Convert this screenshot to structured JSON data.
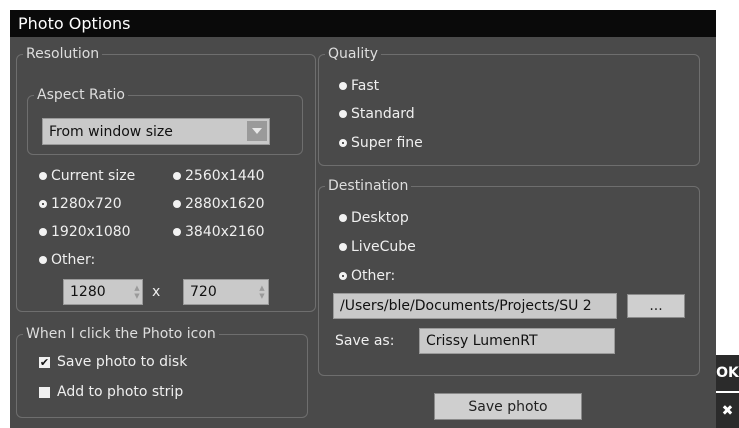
{
  "window": {
    "title": "Photo Options"
  },
  "resolution": {
    "legend": "Resolution",
    "aspect_ratio": {
      "legend": "Aspect Ratio",
      "selected": "From window size"
    },
    "options": [
      {
        "label": "Current size",
        "selected": false
      },
      {
        "label": "2560x1440",
        "selected": false
      },
      {
        "label": "1280x720",
        "selected": true
      },
      {
        "label": "2880x1620",
        "selected": false
      },
      {
        "label": "1920x1080",
        "selected": false
      },
      {
        "label": "3840x2160",
        "selected": false
      },
      {
        "label": "Other:",
        "selected": false
      }
    ],
    "width_value": "1280",
    "height_value": "720",
    "times": "x"
  },
  "photo_icon": {
    "legend": "When I click the Photo icon",
    "save_to_disk": {
      "label": "Save photo to disk",
      "checked": true
    },
    "add_to_strip": {
      "label": "Add to photo strip",
      "checked": false
    }
  },
  "quality": {
    "legend": "Quality",
    "options": [
      {
        "label": "Fast",
        "selected": false
      },
      {
        "label": "Standard",
        "selected": false
      },
      {
        "label": "Super fine",
        "selected": true
      }
    ]
  },
  "destination": {
    "legend": "Destination",
    "options": [
      {
        "label": "Desktop",
        "selected": false
      },
      {
        "label": "LiveCube",
        "selected": false
      },
      {
        "label": "Other:",
        "selected": true
      }
    ],
    "path_value": "/Users/ble/Documents/Projects/SU 2",
    "browse_label": "...",
    "save_as_label": "Save as:",
    "save_as_value": "Crissy LumenRT"
  },
  "actions": {
    "save_photo": "Save photo",
    "ok": "OK",
    "close": "✖"
  },
  "colors": {
    "dialog_bg": "#4a4a4a",
    "titlebar_bg": "#0a0a0a",
    "field_bg": "#c9c9c9"
  }
}
